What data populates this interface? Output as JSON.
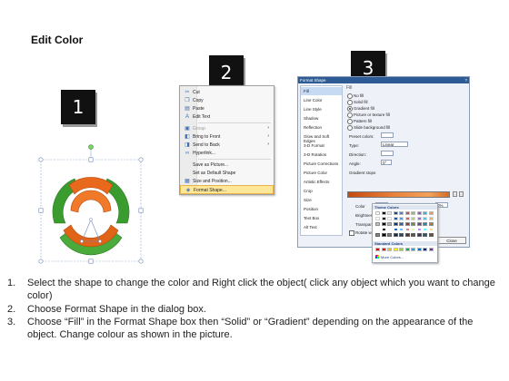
{
  "title": "Edit Color",
  "steps": [
    "1",
    "2",
    "3"
  ],
  "context_menu": {
    "items": [
      {
        "label": "Cut",
        "icon": "scissors-icon",
        "glyph": "✂",
        "disabled": false,
        "arrow": false
      },
      {
        "label": "Copy",
        "icon": "copy-icon",
        "glyph": "❐",
        "disabled": false,
        "arrow": false
      },
      {
        "label": "Paste",
        "icon": "paste-icon",
        "glyph": "📋",
        "disabled": false,
        "arrow": false
      },
      {
        "label": "Edit Text",
        "icon": "edit-text-icon",
        "glyph": "A",
        "disabled": false,
        "arrow": false
      },
      {
        "label": "Group",
        "icon": "group-icon",
        "glyph": "▣",
        "disabled": true,
        "arrow": true
      },
      {
        "label": "Bring to Front",
        "icon": "bring-front-icon",
        "glyph": "◧",
        "disabled": false,
        "arrow": true
      },
      {
        "label": "Send to Back",
        "icon": "send-back-icon",
        "glyph": "◨",
        "disabled": false,
        "arrow": true
      },
      {
        "label": "Hyperlink...",
        "icon": "hyperlink-icon",
        "glyph": "⛓",
        "disabled": false,
        "arrow": false
      },
      {
        "label": "Save as Picture...",
        "icon": "",
        "glyph": "",
        "disabled": false,
        "arrow": false
      },
      {
        "label": "Set as Default Shape",
        "icon": "",
        "glyph": "",
        "disabled": false,
        "arrow": false
      },
      {
        "label": "Size and Position...",
        "icon": "size-position-icon",
        "glyph": "▦",
        "disabled": false,
        "arrow": false
      },
      {
        "label": "Format Shape...",
        "icon": "format-shape-icon",
        "glyph": "◈",
        "disabled": false,
        "arrow": false,
        "highlight": true
      }
    ]
  },
  "dialog": {
    "title": "Format Shape",
    "close": "?",
    "nav": [
      "Fill",
      "Line Color",
      "Line Style",
      "Shadow",
      "Reflection",
      "Glow and Soft Edges",
      "3-D Format",
      "3-D Rotation",
      "Picture Corrections",
      "Picture Color",
      "Artistic Effects",
      "Crop",
      "Size",
      "Position",
      "Text Box",
      "Alt Text"
    ],
    "section": "Fill",
    "options": [
      "No fill",
      "Solid fill",
      "Gradient fill",
      "Picture or texture fill",
      "Pattern fill",
      "Slide background fill"
    ],
    "preset_label": "Preset colors:",
    "type_label": "Type:",
    "type_value": "Linear",
    "direction_label": "Direction:",
    "angle_label": "Angle:",
    "angle_value": "0°",
    "stops_label": "Gradient stops",
    "color_label": "Color",
    "position_label": "Position:",
    "position_value": "0%",
    "brightness_label": "Brightness",
    "transparency_label": "Transparency",
    "rotate_label": "Rotate with shape",
    "close_button": "Close"
  },
  "palette": {
    "theme_label": "Theme Colors",
    "standard_label": "Standard Colors",
    "more_label": "More Colors...",
    "theme_colors": [
      "#ffffff",
      "#000000",
      "#eeece1",
      "#1f497d",
      "#4f81bd",
      "#c0504d",
      "#9bbb59",
      "#8064a2",
      "#4bacc6",
      "#f79646"
    ],
    "standard_colors": [
      "#c00000",
      "#ff0000",
      "#ffc000",
      "#ffff00",
      "#92d050",
      "#00b050",
      "#00b0f0",
      "#0070c0",
      "#002060",
      "#7030a0"
    ]
  },
  "instructions": [
    {
      "num": "1.",
      "text": "Select the shape to change the color and Right click the object( click any object which you want to change color)"
    },
    {
      "num": "2.",
      "text": "Choose Format Shape in the dialog box."
    },
    {
      "num": "3.",
      "text": "Choose “Fill” in the Format Shape box then “Solid” or “Gradient” depending on the appearance of the object. Change colour as shown in the picture."
    }
  ]
}
